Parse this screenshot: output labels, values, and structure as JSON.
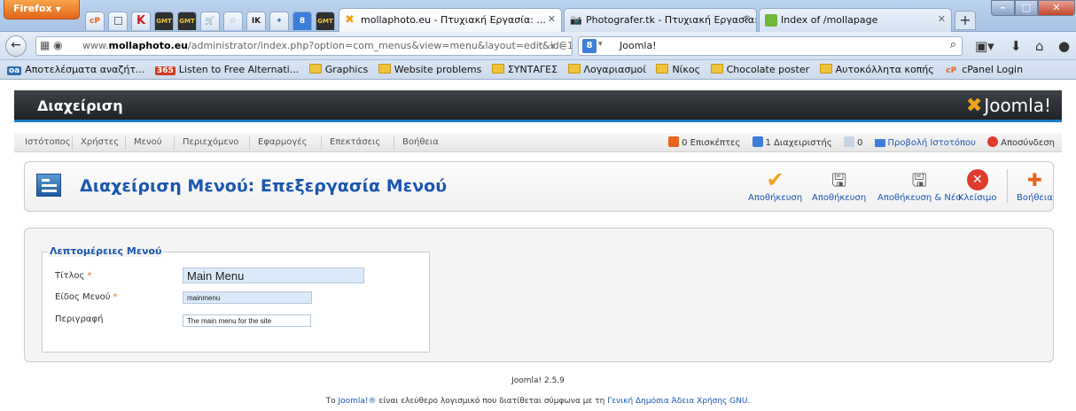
{
  "browser": {
    "app_button": "Firefox",
    "app_tabs": [
      "cP",
      "",
      "K",
      "GMT",
      "GMT",
      "",
      "",
      "IK",
      "",
      "8",
      "GMT"
    ],
    "tabs": [
      {
        "label": "mollaphoto.eu - Πτυχιακή Εργασία: ...",
        "icon": "joomla-favicon",
        "active": true
      },
      {
        "label": "Photografer.tk - Πτυχιακή Εργασία: ...",
        "icon": "camera-favicon",
        "active": false
      },
      {
        "label": "Index of /mollapage",
        "icon": "folder-favicon",
        "active": false
      }
    ],
    "url_prefix": "www.",
    "url_host": "mollaphoto.eu",
    "url_path": "/administrator/index.php?option=com_menus&view=menu&layout=edit&id=1",
    "search_engine": "8",
    "search_value": "Joomla!",
    "bookmarks": [
      {
        "label": "Αποτελέσματα αναζήτ...",
        "badge": "oa",
        "badge_color": "#2b6fb3"
      },
      {
        "label": "Listen to Free Alternati...",
        "badge": "365",
        "badge_color": "#d23c25"
      },
      {
        "label": "Graphics",
        "badge": "",
        "badge_color": ""
      },
      {
        "label": "Website problems",
        "badge": "",
        "badge_color": ""
      },
      {
        "label": "ΣΥΝΤΑΓΕΣ",
        "badge": "",
        "badge_color": ""
      },
      {
        "label": "Λογαριασμοί",
        "badge": "",
        "badge_color": ""
      },
      {
        "label": "Νίκος",
        "badge": "",
        "badge_color": ""
      },
      {
        "label": "Chocolate poster",
        "badge": "",
        "badge_color": ""
      },
      {
        "label": "Αυτοκόλλητα κοπής",
        "badge": "",
        "badge_color": ""
      },
      {
        "label": "cPanel Login",
        "badge": "cP",
        "badge_color": "#e8641c"
      }
    ]
  },
  "header": {
    "title": "Διαχείριση",
    "logo_text": "Joomla!"
  },
  "menu": {
    "items": [
      "Ιστότοπος",
      "Χρήστες",
      "Μενού",
      "Περιεχόμενο",
      "Εφαρμογές",
      "Επεκτάσεις",
      "Βοήθεια"
    ],
    "status": {
      "visitors": "0 Επισκέπτες",
      "admins": "1 Διαχειριστής",
      "messages": "0",
      "view_site": "Προβολή Ιστοτόπου",
      "logout": "Αποσύνδεση"
    }
  },
  "toolbar": {
    "title": "Διαχείριση Μενού: Επεξεργασία Μενού",
    "buttons": [
      {
        "label": "Αποθήκευση",
        "icon": "checkmark-icon",
        "color": "#f0a31a"
      },
      {
        "label": "Αποθήκευση",
        "icon": "save-icon",
        "color": "#555555"
      },
      {
        "label": "Αποθήκευση & Νέο",
        "icon": "save-new-icon",
        "color": "#555555"
      },
      {
        "label": "Κλείσιμο",
        "icon": "close-icon",
        "color": "#e03c2e"
      },
      {
        "label": "Βοήθεια",
        "icon": "lifebuoy-icon",
        "color": "#e8641c"
      }
    ]
  },
  "form": {
    "legend": "Λεπτομέρειες Μενού",
    "title_label": "Τίτλος",
    "title_value": "Main Menu",
    "menutype_label": "Είδος Μενού",
    "menutype_value": "mainmenu",
    "description_label": "Περιγραφή",
    "description_value": "The main menu for the site",
    "required_marker": "*"
  },
  "footer": {
    "version": "Joomla! 2.5.9",
    "license_prefix": "Το ",
    "license_link1": "Joomla!®",
    "license_middle": " είναι ελεύθερο λογισμικό που διατίθεται σύμφωνα με τη ",
    "license_link2": "Γενική Δημόσια Άδεια Χρήσης GNU",
    "license_suffix": "."
  },
  "colors": {
    "brand_blue": "#1b57b1",
    "header_dark": "#2d3035",
    "accent_orange": "#f0a31a",
    "close_red": "#e03c2e"
  }
}
